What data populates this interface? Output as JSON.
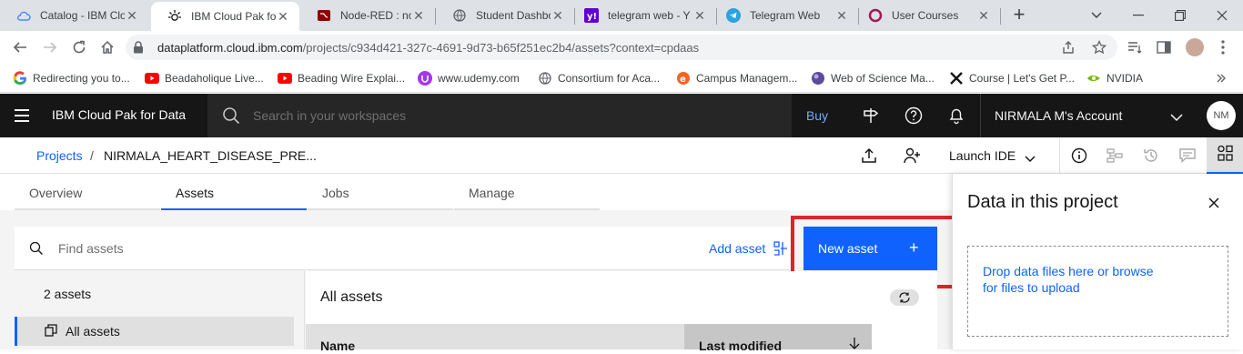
{
  "browser": {
    "tabs": [
      {
        "label": "Catalog - IBM Clo",
        "icon": "cloud-icon"
      },
      {
        "label": "IBM Cloud Pak fo",
        "icon": "ibm-icon"
      },
      {
        "label": "Node-RED : node",
        "icon": "nodered-icon"
      },
      {
        "label": "Student Dashboa",
        "icon": "globe-icon"
      },
      {
        "label": "telegram web - Y",
        "icon": "yahoo-icon"
      },
      {
        "label": "Telegram Web",
        "icon": "telegram-icon"
      },
      {
        "label": "User Courses",
        "icon": "course-icon"
      }
    ],
    "url_host": "dataplatform.cloud.ibm.com",
    "url_path": "/projects/c934d421-327c-4691-9d73-b65f251ec2b4/assets?context=cpdaas",
    "bookmarks": [
      {
        "label": "Redirecting you to...",
        "icon": "google-icon"
      },
      {
        "label": "Beadaholique Live...",
        "icon": "youtube-icon"
      },
      {
        "label": "Beading Wire Explai...",
        "icon": "youtube-icon"
      },
      {
        "label": "www.udemy.com",
        "icon": "udemy-icon"
      },
      {
        "label": "Consortium for Aca...",
        "icon": "globe-icon"
      },
      {
        "label": "Campus Managem...",
        "icon": "campus-icon"
      },
      {
        "label": "Web of Science Ma...",
        "icon": "wos-icon"
      },
      {
        "label": "Course | Let's Get P...",
        "icon": "x-icon"
      },
      {
        "label": "NVIDIA",
        "icon": "nvidia-icon"
      }
    ]
  },
  "header": {
    "brand": "IBM Cloud Pak for Data",
    "search_placeholder": "Search in your workspaces",
    "buy": "Buy",
    "account": "NIRMALA M's Account",
    "avatar_initials": "NM"
  },
  "subheader": {
    "breadcrumb_root": "Projects",
    "breadcrumb_sep": "/",
    "project_name": "NIRMALA_HEART_DISEASE_PRE...",
    "launch_ide": "Launch IDE"
  },
  "tabs": [
    "Overview",
    "Assets",
    "Jobs",
    "Manage"
  ],
  "assets": {
    "find_placeholder": "Find assets",
    "add_asset": "Add asset",
    "new_asset": "New asset",
    "new_asset_plus": "+",
    "count_label": "2 assets",
    "nav_all": "All assets",
    "title": "All assets",
    "columns": [
      "Name",
      "Last modified"
    ]
  },
  "side_panel": {
    "title": "Data in this project",
    "drop_text": "Drop data files here or browse for files to upload"
  },
  "colors": {
    "accent": "#0f62fe",
    "header_bg": "#161616",
    "highlight": "#d9252c"
  }
}
